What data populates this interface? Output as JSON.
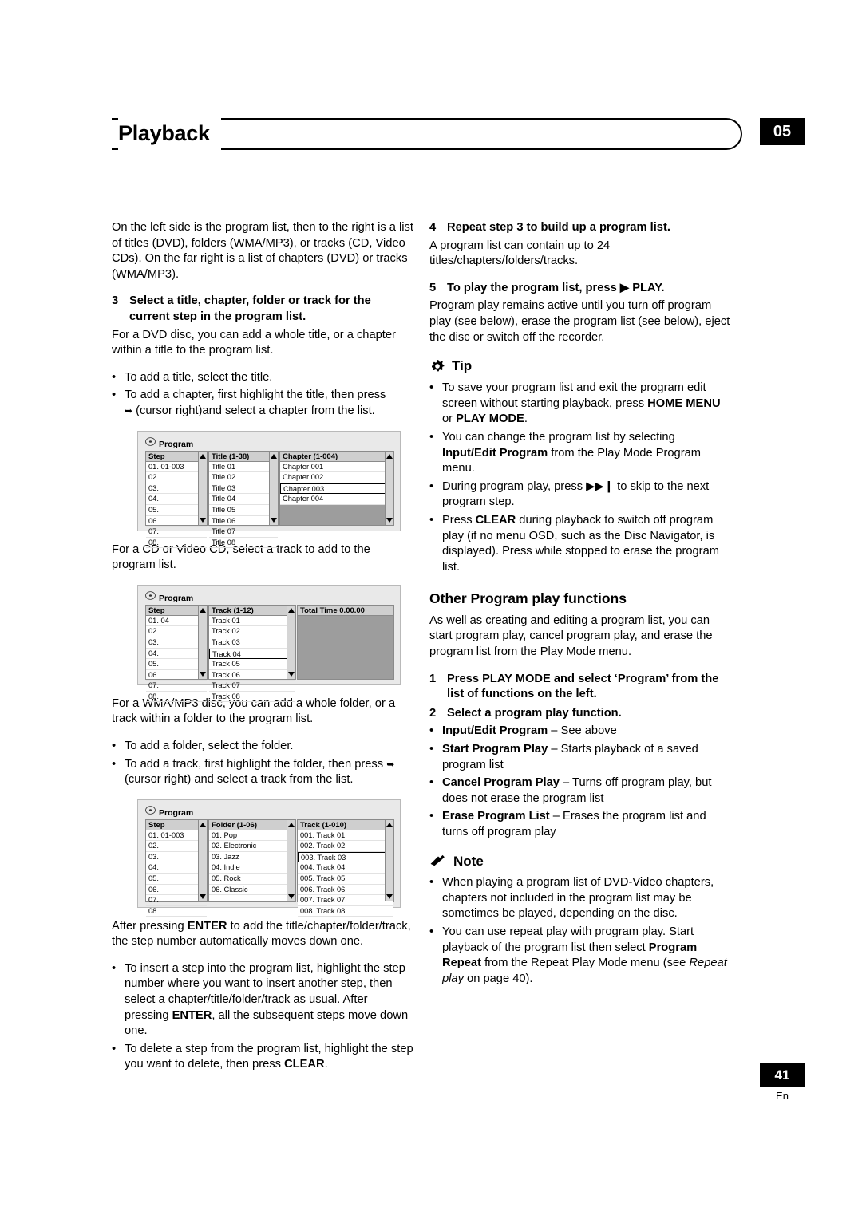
{
  "header": {
    "title": "Playback",
    "chapter_badge": "05"
  },
  "footer": {
    "page_number": "41",
    "language": "En"
  },
  "left_column": {
    "intro": "On the left side is the program list, then to the right is a list of titles (DVD), folders (WMA/MP3), or tracks (CD, Video CDs). On the far right is a list of chapters (DVD) or tracks (WMA/MP3).",
    "step3_num": "3",
    "step3_title": "Select a title, chapter, folder or track for the current step in the program list.",
    "step3_body": "For a DVD disc, you can add a whole title, or a chapter within a title to the program list.",
    "step3_b1": "To add a title, select the title.",
    "step3_b2": "To add a chapter, first highlight the title, then press",
    "step3_b2b": "(cursor right)and select a chapter from the list.",
    "after_fig1": "For a CD or Video CD, select a track to add to the program list.",
    "after_fig2": "For a WMA/MP3 disc, you can add a whole folder, or a track within a folder to the program list.",
    "wma_b1": "To add a folder, select the folder.",
    "wma_b2": "To add a track, first highlight the folder, then press",
    "wma_b2b": "(cursor right) and select a track from the list.",
    "after_fig3_a": "After pressing ",
    "after_fig3_enter": "ENTER",
    "after_fig3_b": " to add the title/chapter/folder/track, the step number automatically moves down one.",
    "ins_b1_a": "To insert a step into the program list, highlight the step number where you want to insert another step, then select a chapter/title/folder/track as usual. After pressing ",
    "ins_b1_enter": "ENTER",
    "ins_b1_b": ", all the subsequent steps move down one.",
    "ins_b2_a": "To delete a step from the program list, highlight the step you want to delete, then press ",
    "ins_b2_clear": "CLEAR",
    "ins_b2_b": "."
  },
  "figures": {
    "fig_dvd": {
      "title": "Program",
      "col1_header": "Step",
      "col2_header": "Title (1-38)",
      "col3_header": "Chapter (1-004)",
      "steps": [
        "01. 01-003",
        "02.",
        "03.",
        "04.",
        "05.",
        "06.",
        "07.",
        "08."
      ],
      "titles": [
        "Title 01",
        "Title 02",
        "Title 03",
        "Title 04",
        "Title 05",
        "Title 06",
        "Title 07",
        "Title 08"
      ],
      "chapters": [
        "Chapter 001",
        "Chapter 002",
        "Chapter 003",
        "Chapter 004"
      ],
      "selected_chapter_index": 2
    },
    "fig_cd": {
      "title": "Program",
      "col1_header": "Step",
      "col2_header": "Track (1-12)",
      "col3_header": "Total Time 0.00.00",
      "steps": [
        "01. 04",
        "02.",
        "03.",
        "04.",
        "05.",
        "06.",
        "07.",
        "08."
      ],
      "tracks": [
        "Track 01",
        "Track 02",
        "Track 03",
        "Track 04",
        "Track 05",
        "Track 06",
        "Track 07",
        "Track 08"
      ],
      "selected_track_index": 3
    },
    "fig_wma": {
      "title": "Program",
      "col1_header": "Step",
      "col2_header": "Folder (1-06)",
      "col3_header": "Track (1-010)",
      "steps": [
        "01. 01-003",
        "02.",
        "03.",
        "04.",
        "05.",
        "06.",
        "07.",
        "08."
      ],
      "folders": [
        "01. Pop",
        "02. Electronic",
        "03. Jazz",
        "04. Indie",
        "05. Rock",
        "06. Classic"
      ],
      "tracks": [
        "001. Track 01",
        "002. Track 02",
        "003. Track 03",
        "004. Track 04",
        "005. Track 05",
        "006. Track 06",
        "007. Track 07",
        "008. Track 08"
      ],
      "selected_track_index": 2
    }
  },
  "right_column": {
    "step4_num": "4",
    "step4_title": "Repeat step 3 to build up a program list.",
    "step4_body": "A program list can contain up to 24 titles/chapters/folders/tracks.",
    "step5_num": "5",
    "step5_title_a": "To play the program list, press ",
    "step5_title_b": "PLAY.",
    "step5_body": "Program play remains active until you turn off program play (see below), erase the program list (see below), eject the disc or switch off the recorder.",
    "tip_label": "Tip",
    "tip_b1_a": "To save your program list and exit the program edit screen without starting playback, press ",
    "tip_b1_bold1": "HOME MENU",
    "tip_b1_mid": " or ",
    "tip_b1_bold2": "PLAY MODE",
    "tip_b1_end": ".",
    "tip_b2_a": "You can change the program list by selecting ",
    "tip_b2_bold1": "Input/Edit Program",
    "tip_b2_b": " from the Play Mode Program menu.",
    "tip_b3_a": "During program play, press ",
    "tip_b3_b": " to skip to the next program step.",
    "tip_b4_a": "Press ",
    "tip_b4_bold": "CLEAR",
    "tip_b4_b": " during playback to switch off program play (if no menu OSD, such as the Disc Navigator, is displayed). Press while stopped to erase the program list.",
    "other_head": "Other Program play functions",
    "other_body": "As well as creating and editing a program list, you can start program play, cancel program play, and erase the program list from the Play Mode menu.",
    "o_step1_num": "1",
    "o_step1_title": "Press PLAY MODE and select ‘Program’ from the list of functions on the left.",
    "o_step2_num": "2",
    "o_step2_title": "Select a program play function.",
    "f1_bold": "Input/Edit Program",
    "f1_rest": " – See above",
    "f2_bold": "Start Program Play",
    "f2_rest": " – Starts playback of a saved program list",
    "f3_bold": "Cancel Program Play",
    "f3_rest": " – Turns off program play, but does not erase the program list",
    "f4_bold": "Erase Program List",
    "f4_rest": " – Erases the program list and turns off program play",
    "note_label": "Note",
    "note_b1": "When playing a program list of DVD-Video chapters, chapters not included in the program list may be sometimes be played, depending on the disc.",
    "note_b2_a": "You can use repeat play with program play. Start playback of the program list then select ",
    "note_b2_bold": "Program Repeat",
    "note_b2_b": " from the Repeat Play Mode menu (see ",
    "note_b2_ital": "Repeat play",
    "note_b2_c": " on page 40)."
  }
}
